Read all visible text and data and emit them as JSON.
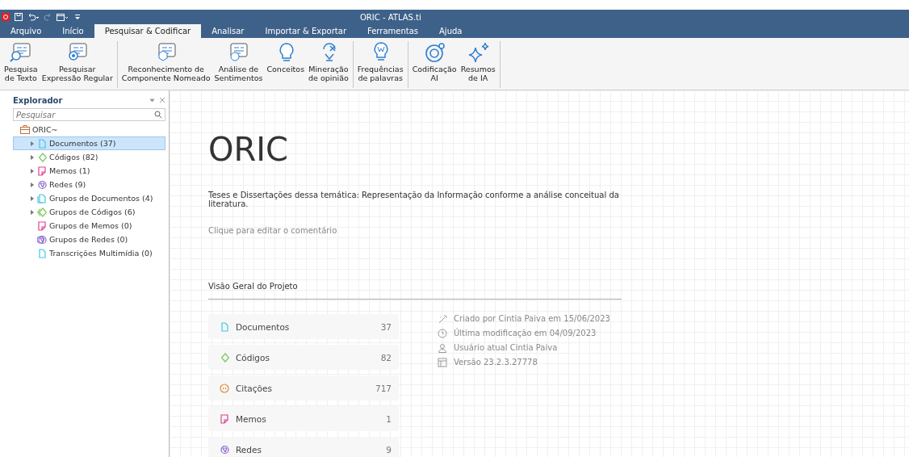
{
  "window": {
    "title": "ORIC - ATLAS.ti"
  },
  "menu_tabs": [
    {
      "label": "Arquivo",
      "selected": false
    },
    {
      "label": "Início",
      "selected": false
    },
    {
      "label": "Pesquisar & Codificar",
      "selected": true
    },
    {
      "label": "Analisar",
      "selected": false
    },
    {
      "label": "Importar & Exportar",
      "selected": false
    },
    {
      "label": "Ferramentas",
      "selected": false
    },
    {
      "label": "Ajuda",
      "selected": false
    }
  ],
  "ribbon_groups": [
    [
      {
        "kind": "text-search",
        "label": "Pesquisa\nde Texto"
      },
      {
        "kind": "regex-search",
        "label": "Pesquisar\nExpressão Regular"
      }
    ],
    [
      {
        "kind": "entity",
        "label": "Reconhecimento de\nComponente Nomeado"
      },
      {
        "kind": "sentiment",
        "label": "Análise de\nSentimentos"
      },
      {
        "kind": "concepts",
        "label": "Conceitos"
      },
      {
        "kind": "opinion",
        "label": "Mineração\nde opinião"
      }
    ],
    [
      {
        "kind": "frequency",
        "label": "Frequências\nde palavras"
      }
    ],
    [
      {
        "kind": "ai-coding",
        "label": "Codificação\nAI"
      },
      {
        "kind": "ai-summary",
        "label": "Resumos\nde IA"
      }
    ]
  ],
  "explorer": {
    "title": "Explorador",
    "search": {
      "placeholder": "Pesquisar"
    },
    "root": {
      "label": "ORIC~",
      "children": [
        {
          "kind": "document",
          "label": "Documentos (37)",
          "expandable": true,
          "selected": true
        },
        {
          "kind": "code",
          "label": "Códigos (82)",
          "expandable": true,
          "selected": false
        },
        {
          "kind": "memo",
          "label": "Memos (1)",
          "expandable": true,
          "selected": false
        },
        {
          "kind": "network",
          "label": "Redes (9)",
          "expandable": true,
          "selected": false
        },
        {
          "kind": "document-group",
          "label": "Grupos de Documentos (4)",
          "expandable": true,
          "selected": false
        },
        {
          "kind": "code-group",
          "label": "Grupos de Códigos (6)",
          "expandable": true,
          "selected": false
        },
        {
          "kind": "memo-group",
          "label": "Grupos de Memos (0)",
          "expandable": false,
          "selected": false
        },
        {
          "kind": "network-group",
          "label": "Grupos de Redes (0)",
          "expandable": false,
          "selected": false
        },
        {
          "kind": "transcription",
          "label": "Transcrições Multimídia (0)",
          "expandable": false,
          "selected": false
        }
      ]
    }
  },
  "project": {
    "title": "ORIC",
    "description": "Teses e Dissertações dessa temática: Representação da Informação conforme a análise conceitual da literatura.",
    "comment_placeholder": "Clique para editar o comentário",
    "overview_title": "Visão Geral do Projeto",
    "overview": [
      {
        "kind": "document",
        "label": "Documentos",
        "count": "37"
      },
      {
        "kind": "code",
        "label": "Códigos",
        "count": "82"
      },
      {
        "kind": "quote",
        "label": "Citações",
        "count": "717"
      },
      {
        "kind": "memo",
        "label": "Memos",
        "count": "1"
      },
      {
        "kind": "network",
        "label": "Redes",
        "count": "9"
      }
    ],
    "info": [
      {
        "kind": "created",
        "text": "Criado por Cintia  Paiva  em 15/06/2023"
      },
      {
        "kind": "modified",
        "text": "Última modificação em 04/09/2023"
      },
      {
        "kind": "user",
        "text": "Usuário atual Cintia  Paiva"
      },
      {
        "kind": "version",
        "text": "Versão 23.2.3.27778"
      }
    ]
  }
}
